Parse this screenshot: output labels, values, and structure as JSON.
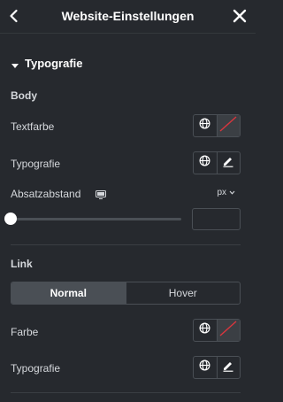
{
  "header": {
    "title": "Website-Einstellungen",
    "back_icon": "chevron-left-icon",
    "close_icon": "close-icon"
  },
  "section": {
    "title": "Typografie",
    "caret_icon": "caret-down-icon"
  },
  "body_group": {
    "title": "Body",
    "textfarbe": {
      "label": "Textfarbe",
      "color_value": "none"
    },
    "typografie": {
      "label": "Typografie"
    },
    "absatzabstand": {
      "label": "Absatzabstand",
      "unit": "px",
      "slider_value": 0,
      "input_value": ""
    }
  },
  "link_group": {
    "title": "Link",
    "tabs": [
      {
        "label": "Normal",
        "active": true
      },
      {
        "label": "Hover",
        "active": false
      }
    ],
    "farbe": {
      "label": "Farbe",
      "color_value": "none"
    },
    "typografie": {
      "label": "Typografie"
    }
  },
  "colors": {
    "background": "#26292e",
    "border": "#4a4f55",
    "active_tab": "#4a4f55",
    "empty_swatch_slash": "#d9363e"
  }
}
